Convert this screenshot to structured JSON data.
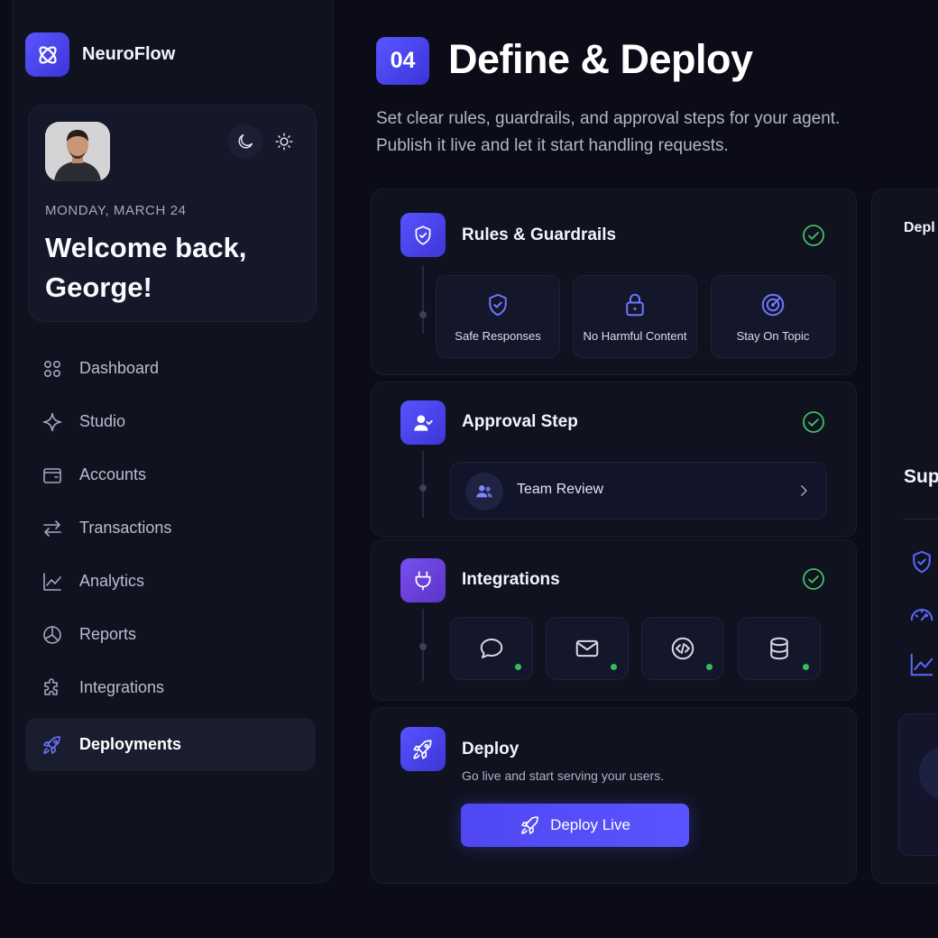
{
  "brand": {
    "name": "NeuroFlow"
  },
  "user": {
    "date": "MONDAY, MARCH 24",
    "welcome": "Welcome back, George!"
  },
  "nav": {
    "items": [
      {
        "label": "Dashboard",
        "icon": "grid-icon"
      },
      {
        "label": "Studio",
        "icon": "sparkle-icon"
      },
      {
        "label": "Accounts",
        "icon": "wallet-icon"
      },
      {
        "label": "Transactions",
        "icon": "swap-arrows-icon"
      },
      {
        "label": "Analytics",
        "icon": "line-chart-icon"
      },
      {
        "label": "Reports",
        "icon": "pie-chart-icon"
      },
      {
        "label": "Integrations",
        "icon": "puzzle-icon"
      },
      {
        "label": "Deployments",
        "icon": "rocket-icon",
        "active": true
      }
    ]
  },
  "header": {
    "step": "04",
    "title": "Define & Deploy",
    "subtitle_line1": "Set clear rules, guardrails, and approval steps for your agent.",
    "subtitle_line2": "Publish it live and let it start handling requests."
  },
  "rules": {
    "title": "Rules & Guardrails",
    "tiles": [
      {
        "label": "Safe Responses",
        "icon": "shield-check-icon"
      },
      {
        "label": "No Harmful Content",
        "icon": "lock-icon"
      },
      {
        "label": "Stay On Topic",
        "icon": "target-icon"
      }
    ]
  },
  "approval": {
    "title": "Approval Step",
    "row_label": "Team Review"
  },
  "integrations": {
    "title": "Integrations",
    "tiles": [
      {
        "icon": "chat-icon"
      },
      {
        "icon": "mail-icon"
      },
      {
        "icon": "code-icon"
      },
      {
        "icon": "database-icon"
      }
    ]
  },
  "deploy": {
    "title": "Deploy",
    "subtitle": "Go live and start serving your users.",
    "button_label": "Deploy Live"
  },
  "right_panel": {
    "title": "Depl",
    "heading": "Sup"
  },
  "colors": {
    "accent": "#5a54ff",
    "success": "#3fbf66",
    "background": "#0b0c17",
    "panel": "#10121f"
  }
}
